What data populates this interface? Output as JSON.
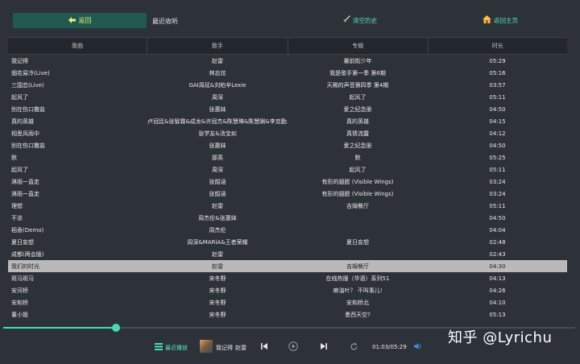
{
  "header": {
    "back_label": "返回",
    "title": "最近收听",
    "clear_history_label": "清空历史",
    "home_label": "返回主页"
  },
  "table": {
    "columns": [
      "歌曲",
      "歌手",
      "专辑",
      "时长"
    ],
    "rows": [
      {
        "song": "我记得",
        "artist": "赵雷",
        "album": "署前街少年",
        "duration": "05:29"
      },
      {
        "song": "烟花易冷(Live)",
        "artist": "林志炫",
        "album": "我是歌手第一季 第6期",
        "duration": "05:16"
      },
      {
        "song": "三国恋(Live)",
        "artist": "GAI周延&刘柏辛Lexie",
        "album": "天赐的声音第四季 第4期",
        "duration": "03:57"
      },
      {
        "song": "起风了",
        "artist": "周深",
        "album": "起风了",
        "duration": "05:11"
      },
      {
        "song": "别在伤口撒盐",
        "artist": "张惠妹",
        "album": "爱之纪念册",
        "duration": "04:50"
      },
      {
        "song": "真的英雄",
        "artist": "卢冠廷&张智霖&成龙&许冠杰&陈慧琳&陈慧娴&李克勤...",
        "album": "真的英雄",
        "duration": "04:15"
      },
      {
        "song": "相思风雨中",
        "artist": "张学友&汤宝如",
        "album": "真情流露",
        "duration": "04:12"
      },
      {
        "song": "别在伤口撒盐",
        "artist": "张惠妹",
        "album": "爱之纪念册",
        "duration": "04:50"
      },
      {
        "song": "默",
        "artist": "那英",
        "album": "默",
        "duration": "05:25"
      },
      {
        "song": "起风了",
        "artist": "周深",
        "album": "起风了",
        "duration": "05:11"
      },
      {
        "song": "淋雨一直走",
        "artist": "张韶涵",
        "album": "有形的翅膀 (Visible Wings)",
        "duration": "03:24"
      },
      {
        "song": "淋雨一直走",
        "artist": "张韶涵",
        "album": "有形的翅膀 (Visible Wings)",
        "duration": "03:24"
      },
      {
        "song": "理想",
        "artist": "赵雷",
        "album": "吉姆餐厅",
        "duration": "05:11"
      },
      {
        "song": "不该",
        "artist": "周杰伦&张惠妹",
        "album": "",
        "duration": "04:50"
      },
      {
        "song": "稻香(Demo)",
        "artist": "周杰伦",
        "album": "",
        "duration": "04:04"
      },
      {
        "song": "夏日妄想",
        "artist": "周深&MARiA&王者荣耀",
        "album": "夏日妄想",
        "duration": "02:48"
      },
      {
        "song": "成都(两会版)",
        "artist": "赵雷",
        "album": "",
        "duration": "02:43"
      },
      {
        "song": "我们的时光",
        "artist": "赵雷",
        "album": "吉姆餐厅",
        "duration": "04:30",
        "selected": true
      },
      {
        "song": "斑马斑马",
        "artist": "宋冬野",
        "album": "在线热搜（华语）系列51",
        "duration": "04:13"
      },
      {
        "song": "安河桥",
        "artist": "宋冬野",
        "album": "麻油叶？ 不叫事儿!",
        "duration": "04:26"
      },
      {
        "song": "安和桥",
        "artist": "宋冬野",
        "album": "安和桥北",
        "duration": "04:10"
      },
      {
        "song": "董小姐",
        "artist": "宋冬野",
        "album": "墨西天空?",
        "duration": "05:13"
      }
    ]
  },
  "progress": {
    "fraction": 0.197
  },
  "player": {
    "recent_label": "最近播放",
    "song": "我记得",
    "artist": "赵雷",
    "time": "01:03/05:29"
  },
  "watermark": "知乎 @Lyrichu",
  "colors": {
    "accent": "#3ee0b0",
    "back_button_bg": "#1f5a50",
    "back_button_text": "#eaf27a",
    "selected_row_bg": "#b9b9b9",
    "background": "#2d3138",
    "header_bg": "#23272c"
  },
  "icons": {
    "back": "back-arrow-icon",
    "clear_history": "broom-icon",
    "home": "home-icon",
    "recent": "recent-play-icon",
    "prev": "skip-previous-icon",
    "play_pause": "play-pause-icon",
    "next": "skip-next-icon",
    "loop": "loop-icon",
    "volume": "volume-icon"
  }
}
